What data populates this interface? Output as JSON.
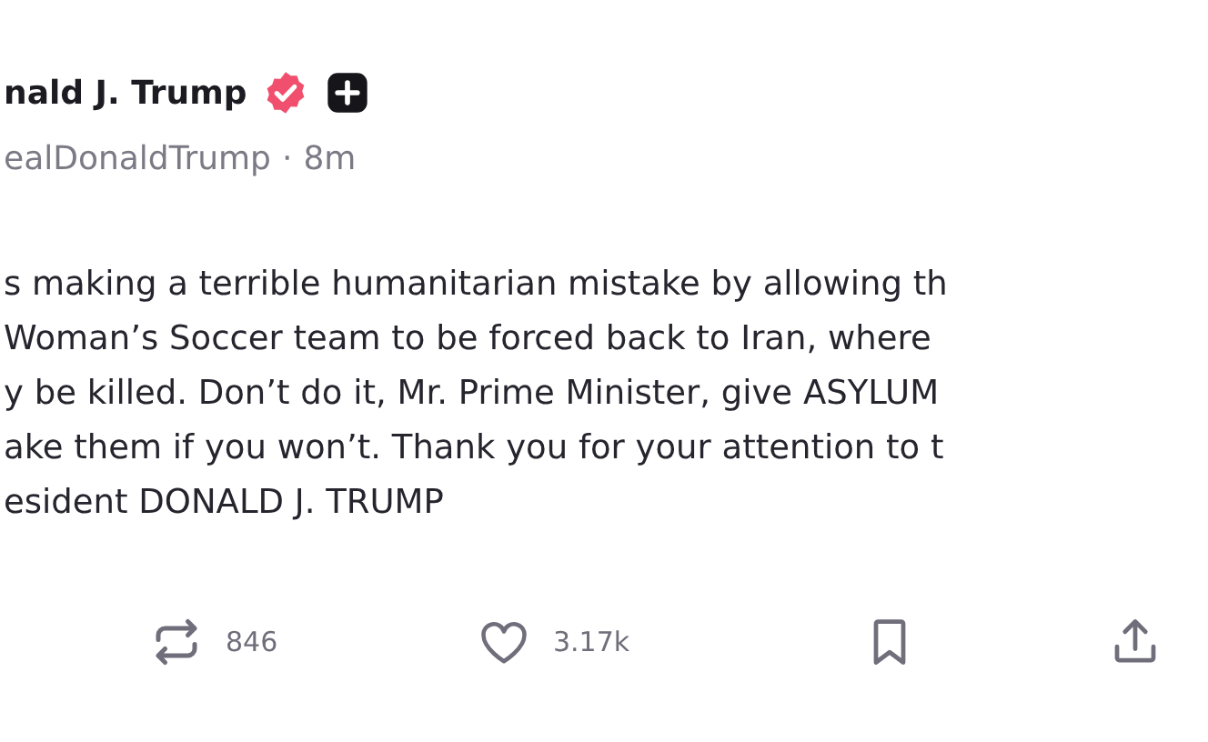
{
  "author": {
    "name": "nald J. Trump",
    "verified": true,
    "handle": "ealDonaldTrump",
    "separator": "·",
    "time": "8m"
  },
  "body_lines": [
    "s making a terrible humanitarian mistake by allowing th",
    "Woman’s Soccer team to be forced back to Iran, where",
    "y be killed. Don’t do it, Mr. Prime Minister, give ASYLUM",
    "ake them if you won’t. Thank you for your attention to t",
    "esident DONALD J. TRUMP"
  ],
  "actions": [
    {
      "kind": "repost",
      "count": "846"
    },
    {
      "kind": "like",
      "count": "3.17k"
    },
    {
      "kind": "bookmark"
    },
    {
      "kind": "share"
    }
  ]
}
